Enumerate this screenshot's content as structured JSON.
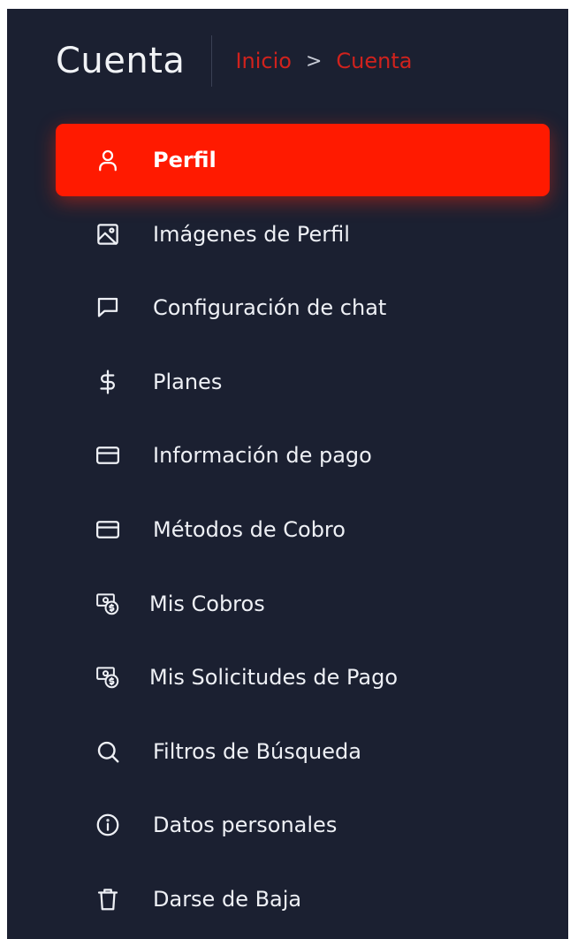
{
  "header": {
    "title": "Cuenta",
    "breadcrumb": {
      "home": "Inicio",
      "separator": ">",
      "current": "Cuenta"
    }
  },
  "colors": {
    "background": "#1b2031",
    "accent": "#ff1a00",
    "breadcrumb": "#d0221d",
    "text": "#eef0f5"
  },
  "menu": {
    "items": [
      {
        "label": "Perfil",
        "icon": "user-icon",
        "active": true
      },
      {
        "label": "Imágenes de Perfil",
        "icon": "image-icon",
        "active": false
      },
      {
        "label": "Configuración de chat",
        "icon": "chat-icon",
        "active": false
      },
      {
        "label": "Planes",
        "icon": "dollar-icon",
        "active": false
      },
      {
        "label": "Información de pago",
        "icon": "credit-card-icon",
        "active": false
      },
      {
        "label": "Métodos de Cobro",
        "icon": "credit-card-icon",
        "active": false
      },
      {
        "label": "Mis Cobros",
        "icon": "money-bill-icon",
        "active": false
      },
      {
        "label": "Mis Solicitudes de Pago",
        "icon": "money-bill-icon",
        "active": false
      },
      {
        "label": "Filtros de Búsqueda",
        "icon": "search-icon",
        "active": false
      },
      {
        "label": "Datos personales",
        "icon": "info-icon",
        "active": false
      },
      {
        "label": "Darse de Baja",
        "icon": "trash-icon",
        "active": false
      }
    ]
  }
}
